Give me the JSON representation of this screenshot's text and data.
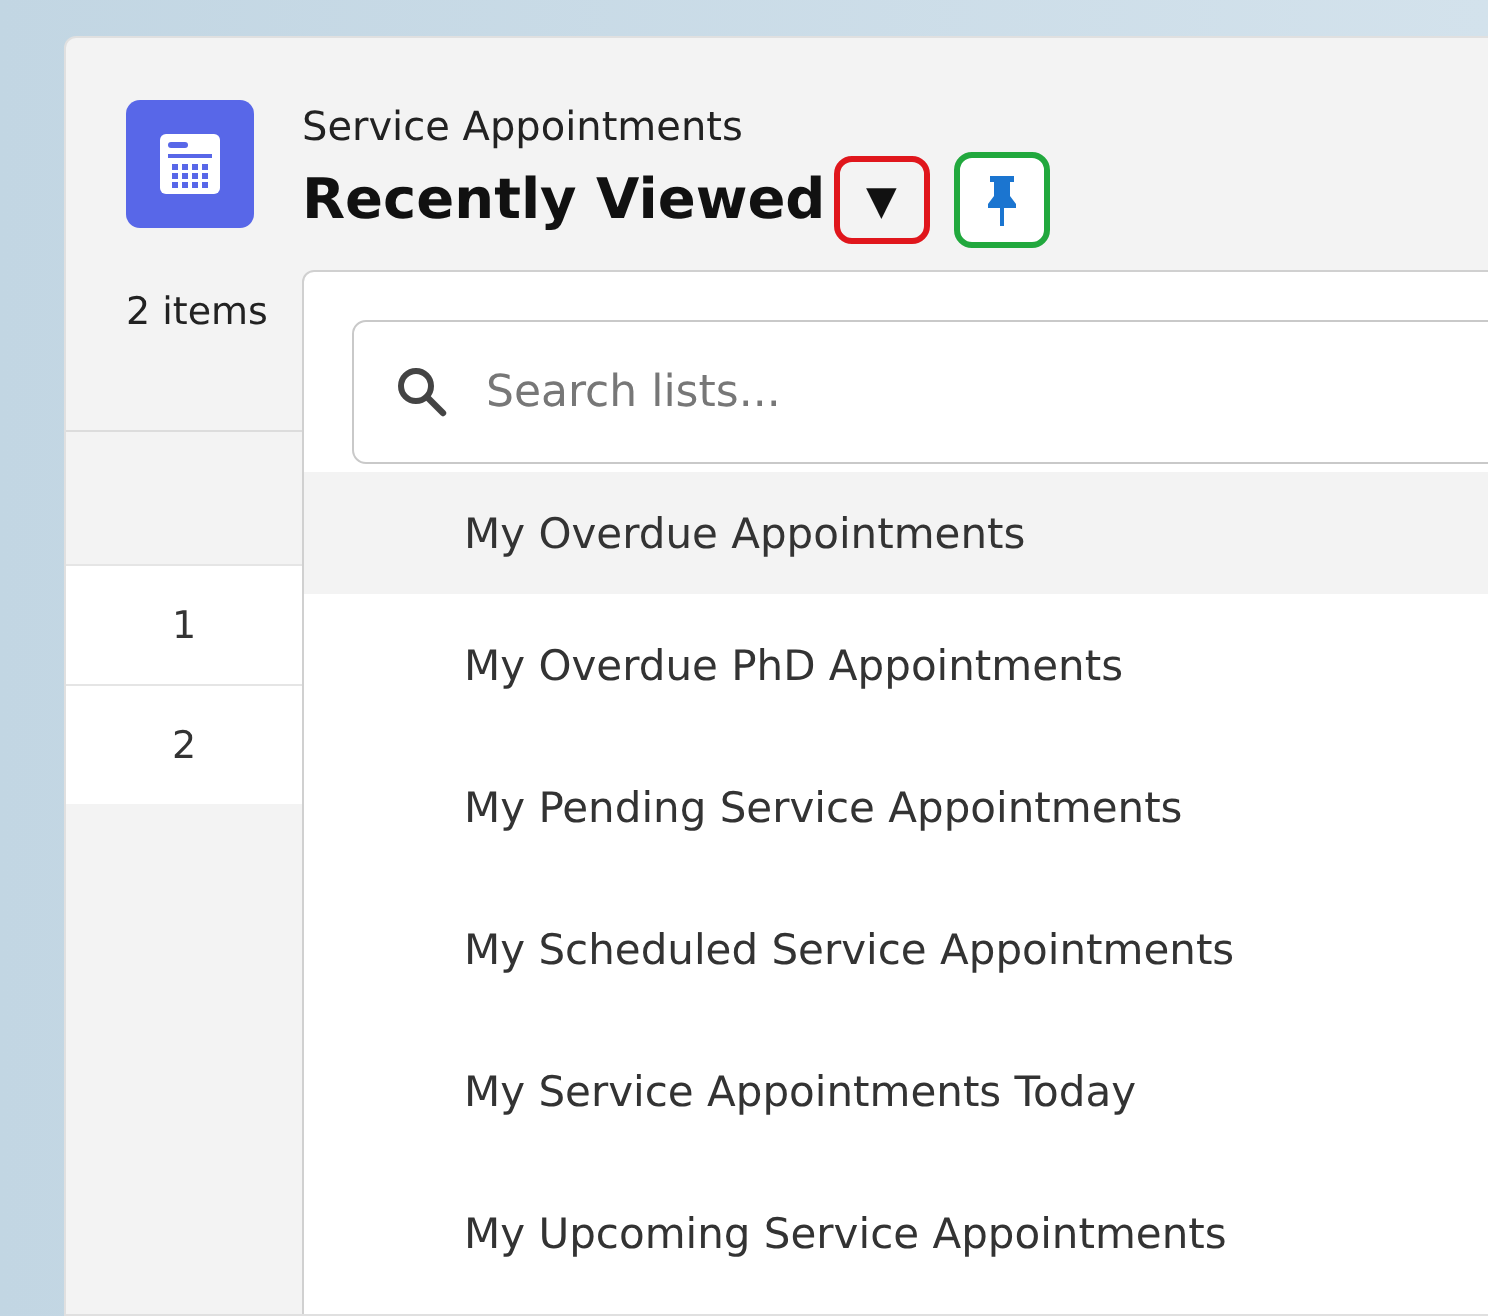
{
  "header": {
    "object_name": "Service Appointments",
    "list_name": "Recently Viewed"
  },
  "list_controls": {
    "dropdown_button": "▼",
    "pin_button": true
  },
  "summary": "2 items",
  "table": {
    "rows": [
      {
        "number": "1"
      },
      {
        "number": "2"
      }
    ]
  },
  "list_menu": {
    "search": {
      "placeholder": "Search lists..."
    },
    "items": [
      {
        "label": "My Overdue Appointments",
        "selected": true
      },
      {
        "label": "My Overdue PhD Appointments",
        "selected": false
      },
      {
        "label": "My Pending Service Appointments",
        "selected": false
      },
      {
        "label": "My Scheduled Service Appointments",
        "selected": false
      },
      {
        "label": "My Service Appointments Today",
        "selected": false
      },
      {
        "label": "My Upcoming Service Appointments",
        "selected": false
      }
    ]
  }
}
